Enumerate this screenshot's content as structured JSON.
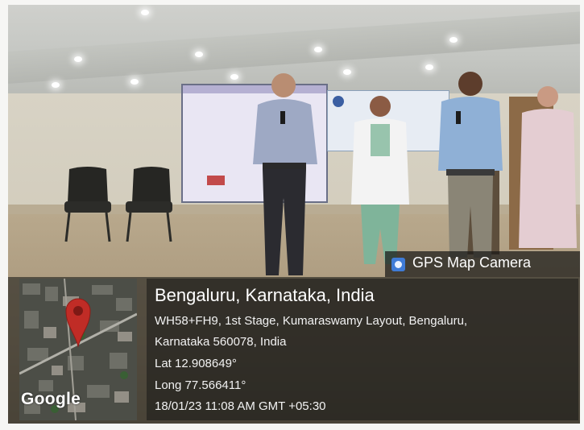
{
  "watermark": {
    "app_name": "GPS Map Camera",
    "app_icon": "gps-camera-icon"
  },
  "location": {
    "title": "Bengaluru, Karnataka, India",
    "address_line1": "WH58+FH9, 1st Stage, Kumaraswamy Layout, Bengaluru,",
    "address_line2": "Karnataka 560078, India",
    "lat": "Lat 12.908649°",
    "long": "Long 77.566411°",
    "datetime": "18/01/23 11:08 AM GMT +05:30"
  },
  "map": {
    "provider_label": "Google",
    "pin_color": "#d9302a"
  },
  "colors": {
    "overlay": "#1e1e1c",
    "badge_icon": "#3f7bd6"
  }
}
